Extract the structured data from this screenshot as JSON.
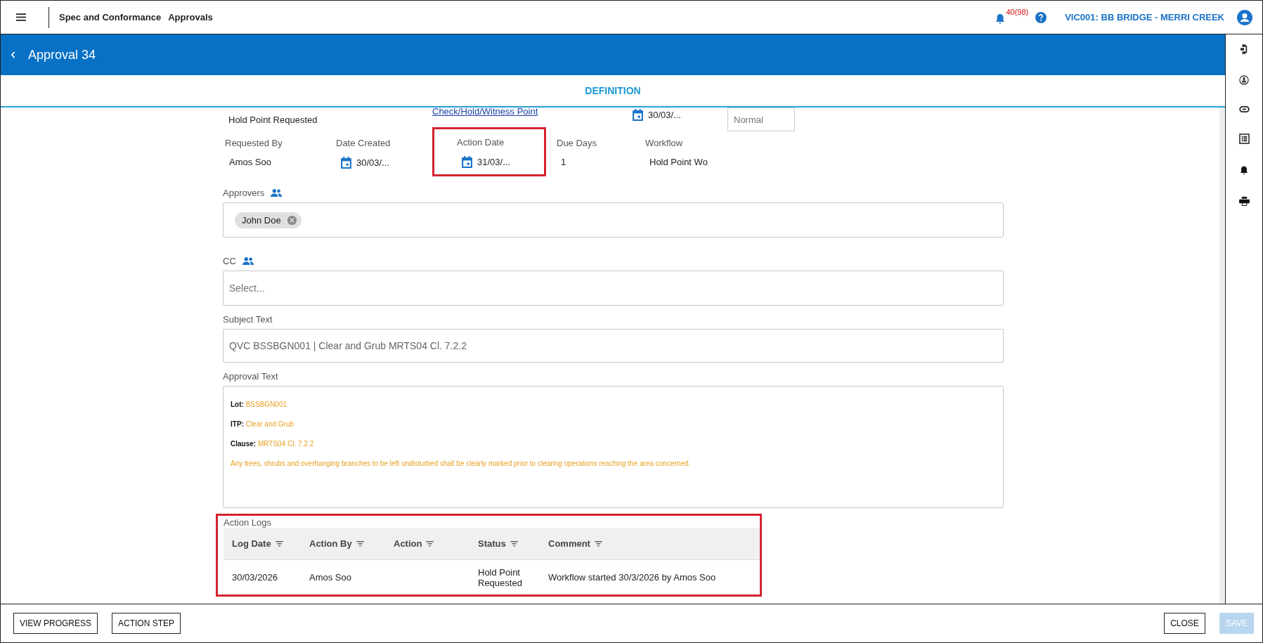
{
  "top_bar": {
    "module": "Spec and Conformance",
    "page": "Approvals",
    "notification_count": "40(98)",
    "project": "VIC001: BB BRIDGE - MERRI CREEK"
  },
  "header": {
    "title": "Approval 34"
  },
  "tabs": [
    {
      "label": "DEFINITION",
      "selected": true
    }
  ],
  "summary_row": {
    "status": "Hold Point Requested",
    "type_link": "Check/Hold/Witness Point",
    "date": "30/03/...",
    "priority_placeholder": "Normal"
  },
  "details": [
    {
      "kind": "text",
      "label": "Requested By",
      "value": "Amos Soo",
      "highlighted": false
    },
    {
      "kind": "date",
      "label": "Date Created",
      "value": "30/03/...",
      "highlighted": false
    },
    {
      "kind": "date",
      "label": "Action Date",
      "value": "31/03/...",
      "highlighted": true
    },
    {
      "kind": "text",
      "label": "Due Days",
      "value": "1",
      "highlighted": false
    },
    {
      "kind": "text",
      "label": "Workflow",
      "value": "Hold Point Wo",
      "highlighted": false
    }
  ],
  "approvers": {
    "label": "Approvers",
    "chips": [
      "John Doe"
    ]
  },
  "cc": {
    "label": "CC",
    "placeholder": "Select..."
  },
  "subject": {
    "label": "Subject Text",
    "value": "QVC BSSBGN001 | Clear and Grub MRTS04 Cl. 7.2.2"
  },
  "approval_text": {
    "label": "Approval Text",
    "lines": [
      {
        "kind": "pair",
        "key": "Lot:",
        "value": "BSSBGN001"
      },
      {
        "kind": "pair",
        "key": "ITP:",
        "value": "Clear and Grub"
      },
      {
        "kind": "pair",
        "key": "Clause:",
        "value": "MRTS04 Cl. 7.2.2"
      },
      {
        "kind": "note",
        "value": "Any trees, shrubs and overhanging branches to be left undisturbed shall be clearly marked prior to clearing operations reaching the area concerned."
      }
    ]
  },
  "action_logs": {
    "label": "Action Logs",
    "highlighted": true,
    "columns": [
      "Log Date",
      "Action By",
      "Action",
      "Status",
      "Comment"
    ],
    "rows": [
      [
        "30/03/2026",
        "Amos Soo",
        "",
        "Hold Point Requested",
        "Workflow started 30/3/2026 by Amos Soo"
      ]
    ]
  },
  "footer": {
    "left_buttons": [
      "VIEW PROGRESS",
      "ACTION STEP"
    ],
    "right_buttons": [
      {
        "label": "CLOSE",
        "disabled": false
      },
      {
        "label": "SAVE",
        "disabled": true
      }
    ]
  }
}
